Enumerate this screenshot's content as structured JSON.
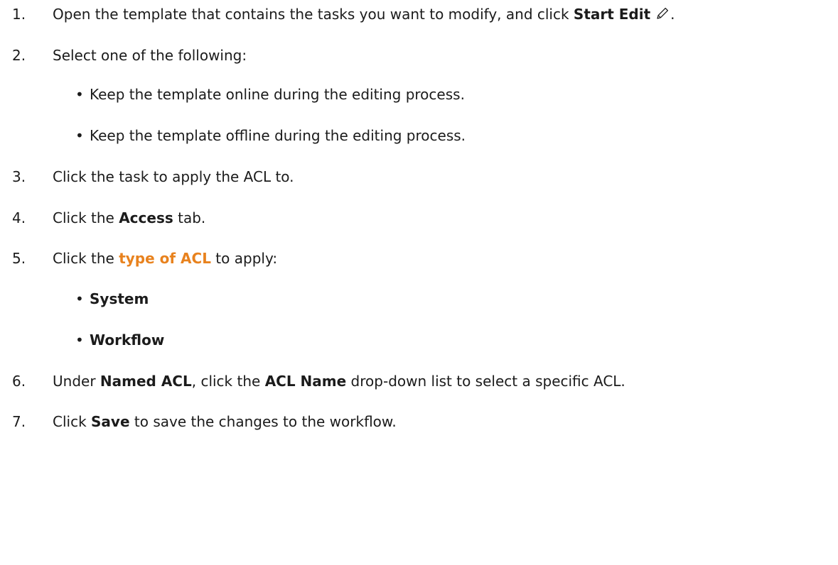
{
  "steps": [
    {
      "num": "1.",
      "pre": "Open the template that contains the tasks you want to modify, and click ",
      "bold": "Start Edit",
      "post": "."
    },
    {
      "num": "2.",
      "text": "Select one of the following:",
      "options": [
        "Keep the template online during the editing process.",
        "Keep the template offline during the editing process."
      ]
    },
    {
      "num": "3.",
      "text": "Click the task to apply the ACL to."
    },
    {
      "num": "4.",
      "pre": "Click the ",
      "bold": "Access",
      "post": " tab."
    },
    {
      "num": "5.",
      "pre": "Click the ",
      "link": "type of ACL",
      "post": " to apply:",
      "options": [
        "System",
        "Workflow"
      ]
    },
    {
      "num": "6.",
      "pre": "Under ",
      "bold1": "Named ACL",
      "mid": ", click the ",
      "bold2": "ACL Name",
      "post": " drop-down list to select a specific ACL."
    },
    {
      "num": "7.",
      "pre": "Click ",
      "bold": "Save",
      "post": " to save the changes to the workflow."
    }
  ],
  "bullet_char": "•",
  "colors": {
    "text": "#1b1b1b",
    "link": "#e8821e",
    "background": "#ffffff"
  },
  "icons": {
    "start_edit": "pencil-icon"
  }
}
